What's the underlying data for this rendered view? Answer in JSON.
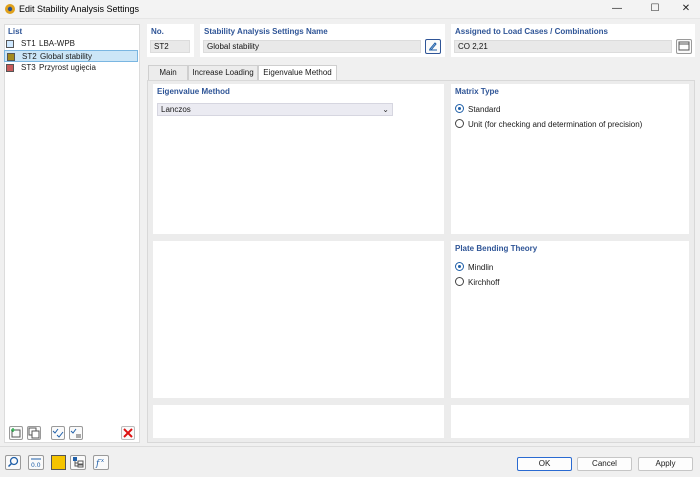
{
  "window": {
    "title": "Edit Stability Analysis Settings"
  },
  "list": {
    "header": "List",
    "items": [
      {
        "code": "ST1",
        "name": "LBA-WPB",
        "color": "#cfe8ff",
        "selected": false
      },
      {
        "code": "ST2",
        "name": "Global stability",
        "color": "#a38a1e",
        "selected": true
      },
      {
        "code": "ST3",
        "name": "Przyrost ugięcia",
        "color": "#c85a5a",
        "selected": false
      }
    ]
  },
  "header": {
    "no_label": "No.",
    "no_value": "ST2",
    "name_label": "Stability Analysis Settings Name",
    "name_value": "Global stability",
    "assigned_label": "Assigned to Load Cases / Combinations",
    "assigned_value": "CO 2,21"
  },
  "tabs": [
    {
      "label": "Main",
      "active": false
    },
    {
      "label": "Increase Loading",
      "active": false
    },
    {
      "label": "Eigenvalue Method",
      "active": true
    }
  ],
  "eigenvalue": {
    "header": "Eigenvalue Method",
    "selected": "Lanczos"
  },
  "matrix": {
    "header": "Matrix Type",
    "options": [
      {
        "label": "Standard",
        "checked": true
      },
      {
        "label": "Unit (for checking and determination of precision)",
        "checked": false
      }
    ]
  },
  "plate": {
    "header": "Plate Bending Theory",
    "options": [
      {
        "label": "Mindlin",
        "checked": true
      },
      {
        "label": "Kirchhoff",
        "checked": false
      }
    ]
  },
  "buttons": {
    "ok": "OK",
    "cancel": "Cancel",
    "apply": "Apply"
  },
  "colors": {
    "accent": "#2f5597",
    "selected_row": "#cce6f7",
    "highlight_swatch": "#f5c400"
  }
}
